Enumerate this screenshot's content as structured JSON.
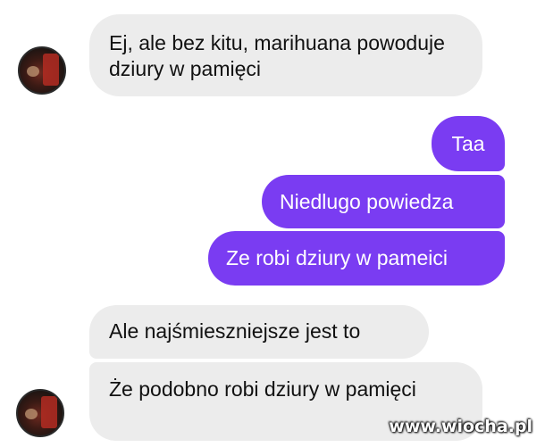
{
  "conversation": {
    "messages": [
      {
        "side": "incoming",
        "text": "Ej, ale bez kitu, marihuana powoduje dziury w pamięci"
      },
      {
        "side": "outgoing",
        "text": "Taa"
      },
      {
        "side": "outgoing",
        "text": "Niedlugo powiedza"
      },
      {
        "side": "outgoing",
        "text": "Ze robi dziury w pameici"
      },
      {
        "side": "incoming",
        "text": "Ale najśmieszniejsze jest to"
      },
      {
        "side": "incoming",
        "text": "Że podobno robi dziury w pamięci"
      }
    ]
  },
  "watermark": "www.wiocha.pl",
  "colors": {
    "incoming_bubble": "#ececec",
    "outgoing_bubble": "#7a3cf2",
    "background": "#ffffff"
  }
}
